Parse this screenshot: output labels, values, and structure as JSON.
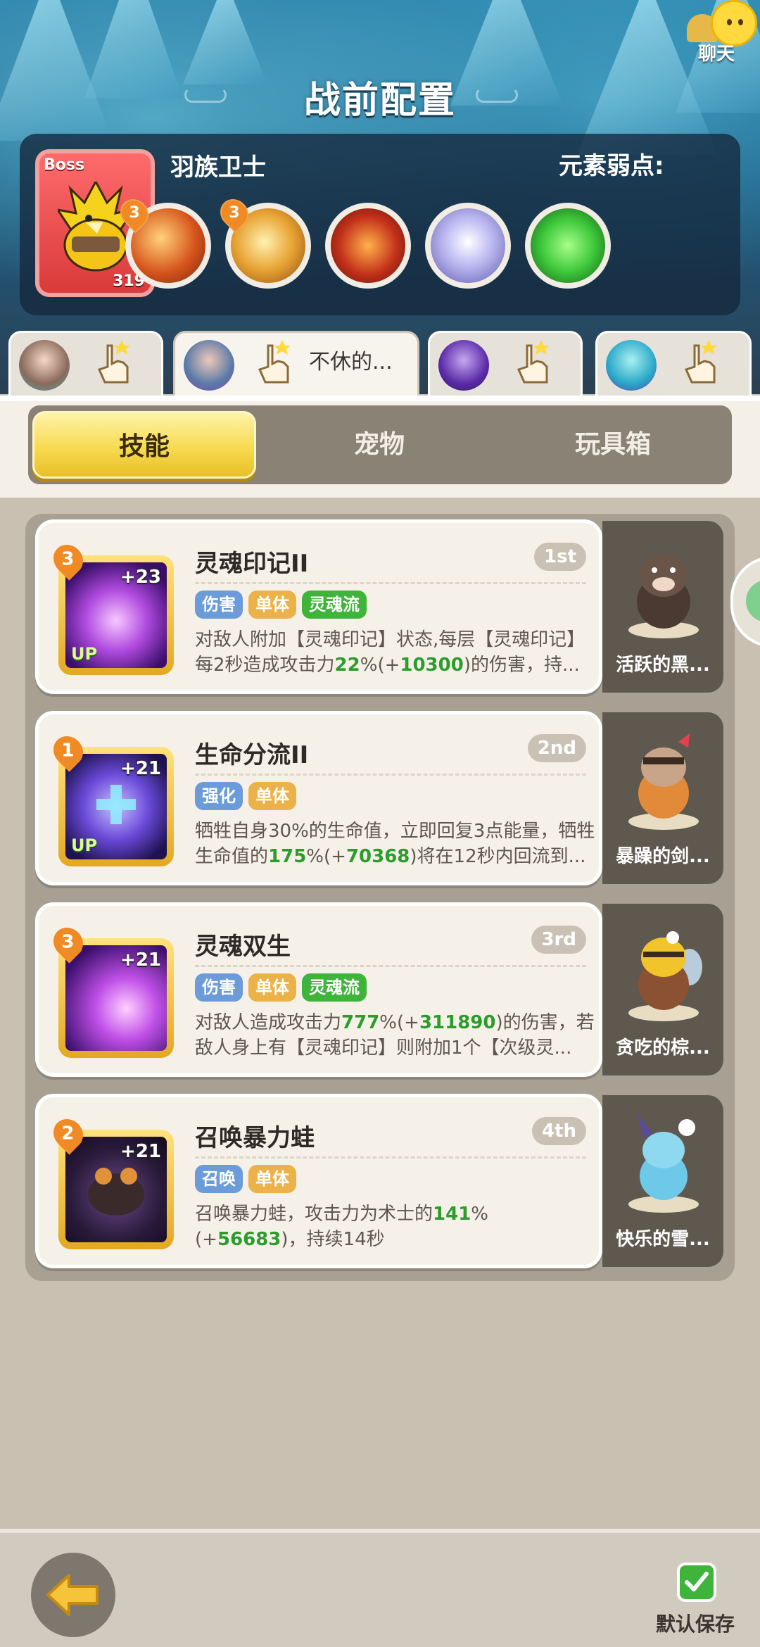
{
  "header": {
    "title": "战前配置"
  },
  "boss": {
    "tag": "Boss",
    "name": "羽族卫士",
    "level": "319",
    "weakness_label": "元素弱点:"
  },
  "chat": {
    "label": "聊天"
  },
  "elements": [
    {
      "icon": "fire-bolt-orb-icon",
      "badge": "3"
    },
    {
      "icon": "gold-swirl-orb-icon",
      "badge": "3"
    },
    {
      "icon": "fire-slash-orb-icon",
      "badge": ""
    },
    {
      "icon": "wind-orb-icon",
      "badge": ""
    },
    {
      "icon": "poison-slime-orb-icon",
      "badge": ""
    }
  ],
  "team_slots": [
    {
      "name": ""
    },
    {
      "name": "不休的..."
    },
    {
      "name": ""
    },
    {
      "name": ""
    }
  ],
  "tabs": [
    {
      "label": "技能",
      "active": true
    },
    {
      "label": "宠物",
      "active": false
    },
    {
      "label": "玩具箱",
      "active": false
    }
  ],
  "skills": [
    {
      "title": "灵魂印记II",
      "rank": "1st",
      "level": "3",
      "plus": "+23",
      "up": "UP",
      "tags": [
        "伤害",
        "单体",
        "灵魂流"
      ],
      "desc_a": "对敌人附加【灵魂印记】状态,每层【灵魂印记】每2秒造成攻击力",
      "desc_h1": "22",
      "desc_b": "%(+",
      "desc_h2": "10300",
      "desc_c": ")的伤害，持...",
      "pet": "活跃的黑..."
    },
    {
      "title": "生命分流II",
      "rank": "2nd",
      "level": "1",
      "plus": "+21",
      "up": "UP",
      "tags": [
        "强化",
        "单体"
      ],
      "desc_a": "牺牲自身30%的生命值，立即回复3点能量，牺牲生命值的",
      "desc_h1": "175",
      "desc_b": "%(+",
      "desc_h2": "70368",
      "desc_c": ")将在12秒内回流到...",
      "pet": "暴躁的剑..."
    },
    {
      "title": "灵魂双生",
      "rank": "3rd",
      "level": "3",
      "plus": "+21",
      "up": "",
      "tags": [
        "伤害",
        "单体",
        "灵魂流"
      ],
      "desc_a": "对敌人造成攻击力",
      "desc_h1": "777",
      "desc_b": "%(+",
      "desc_h2": "311890",
      "desc_c": ")的伤害，若敌人身上有【灵魂印记】则附加1个【次级灵...",
      "pet": "贪吃的棕..."
    },
    {
      "title": "召唤暴力蛙",
      "rank": "4th",
      "level": "2",
      "plus": "+21",
      "up": "",
      "tags": [
        "召唤",
        "单体"
      ],
      "desc_a": "召唤暴力蛙，攻击力为术士的",
      "desc_h1": "141",
      "desc_b": "%(+",
      "desc_h2": "56683",
      "desc_c": ")，持续14秒",
      "pet": "快乐的雪..."
    }
  ],
  "footer": {
    "save_label": "默认保存"
  }
}
